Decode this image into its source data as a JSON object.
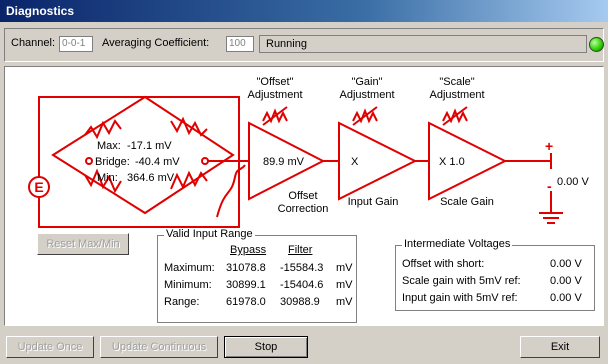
{
  "window": {
    "title": "Diagnostics"
  },
  "toolbar": {
    "channel_label": "Channel:",
    "channel_value": "0-0-1",
    "averaging_label": "Averaging Coefficient:",
    "averaging_value": "100",
    "status_text": "Running",
    "led_color": "#2bcc00"
  },
  "bridge": {
    "max_label": "Max:",
    "max_value": "-17.1 mV",
    "bridge_label": "Bridge:",
    "bridge_value": "-40.4 mV",
    "min_label": "Min:",
    "min_value": "364.6 mV",
    "excitation_glyph": "E"
  },
  "stages": {
    "offset": {
      "title_line1": "\"Offset\"",
      "title_line2": "Adjustment",
      "value": "89.9 mV",
      "caption_line1": "Offset",
      "caption_line2": "Correction"
    },
    "gain": {
      "title_line1": "\"Gain\"",
      "title_line2": "Adjustment",
      "value": "X",
      "caption": "Input Gain"
    },
    "scale": {
      "title_line1": "\"Scale\"",
      "title_line2": "Adjustment",
      "value": "X 1.0",
      "caption": "Scale Gain"
    }
  },
  "output": {
    "plus": "+",
    "minus": "-",
    "value": "0.00 V"
  },
  "reset_button": "Reset Max/Min",
  "valid_range": {
    "title": "Valid Input Range",
    "col_bypass": "Bypass",
    "col_filter": "Filter",
    "rows": [
      {
        "label": "Maximum:",
        "bypass": "31078.8",
        "filter": "-15584.3",
        "unit": "mV"
      },
      {
        "label": "Minimum:",
        "bypass": "30899.1",
        "filter": "-15404.6",
        "unit": "mV"
      },
      {
        "label": "Range:",
        "bypass": "61978.0",
        "filter": "30988.9",
        "unit": "mV"
      }
    ]
  },
  "intermediate": {
    "title": "Intermediate Voltages",
    "rows": [
      {
        "label": "Offset with short:",
        "value": "0.00 V"
      },
      {
        "label": "Scale gain with 5mV ref:",
        "value": "0.00 V"
      },
      {
        "label": "Input gain with 5mV ref:",
        "value": "0.00 V"
      }
    ]
  },
  "footer": {
    "update_once": "Update Once",
    "update_continuous": "Update Continuous",
    "stop": "Stop",
    "exit": "Exit"
  },
  "colors": {
    "circuit": "#e00000"
  }
}
